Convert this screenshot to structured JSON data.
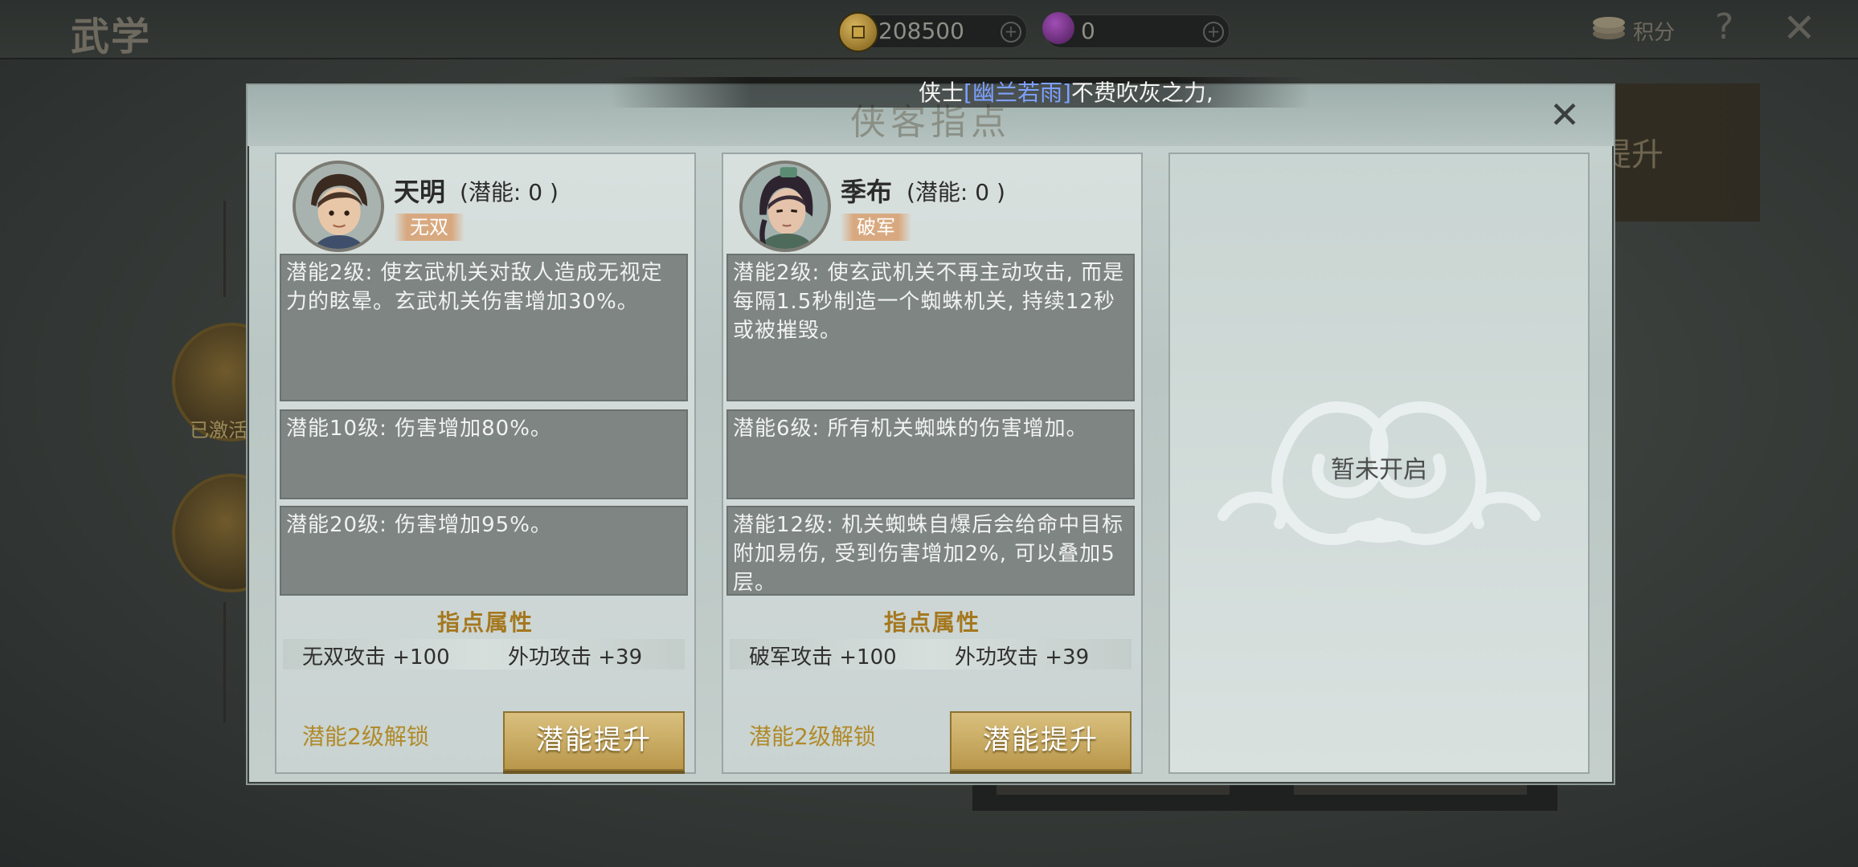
{
  "background": {
    "title": "武学",
    "currency": [
      {
        "icon": "coin-icon",
        "value": "208500"
      },
      {
        "icon": "gem-icon",
        "value": "0"
      }
    ],
    "points_label": "积分",
    "side_panel_text": "提升",
    "round_button_label": "已激活"
  },
  "announcement": {
    "prefix": "侠士",
    "highlight": "[幽兰若雨]",
    "suffix": "不费吹灰之力,",
    "highlight_color": "#7ea0ff"
  },
  "dialog": {
    "title": "侠客指点",
    "heroes": [
      {
        "name": "天明",
        "potential": "(潜能: 0 )",
        "tag": "无双",
        "skills": [
          "潜能2级: 使玄武机关对敌人造成无视定力的眩晕。玄武机关伤害增加30%。",
          "潜能10级: 伤害增加80%。",
          "潜能20级: 伤害增加95%。"
        ],
        "attr_title": "指点属性",
        "attrs": [
          "无双攻击 +100",
          "外功攻击 +39"
        ],
        "unlock": "潜能2级解锁",
        "button": "潜能提升"
      },
      {
        "name": "季布",
        "potential": "(潜能: 0 )",
        "tag": "破军",
        "skills": [
          "潜能2级: 使玄武机关不再主动攻击, 而是每隔1.5秒制造一个蜘蛛机关, 持续12秒或被摧毁。",
          "潜能6级: 所有机关蜘蛛的伤害增加。",
          "潜能12级: 机关蜘蛛自爆后会给命中目标附加易伤, 受到伤害增加2%, 可以叠加5层。"
        ],
        "attr_title": "指点属性",
        "attrs": [
          "破军攻击 +100",
          "外功攻击 +39"
        ],
        "unlock": "潜能2级解锁",
        "button": "潜能提升"
      }
    ],
    "locked_slot": "暂未开启"
  },
  "colors": {
    "accent_gold": "#a5781f",
    "button_gold": "#c9aa60",
    "skill_box": "#7e8583"
  }
}
